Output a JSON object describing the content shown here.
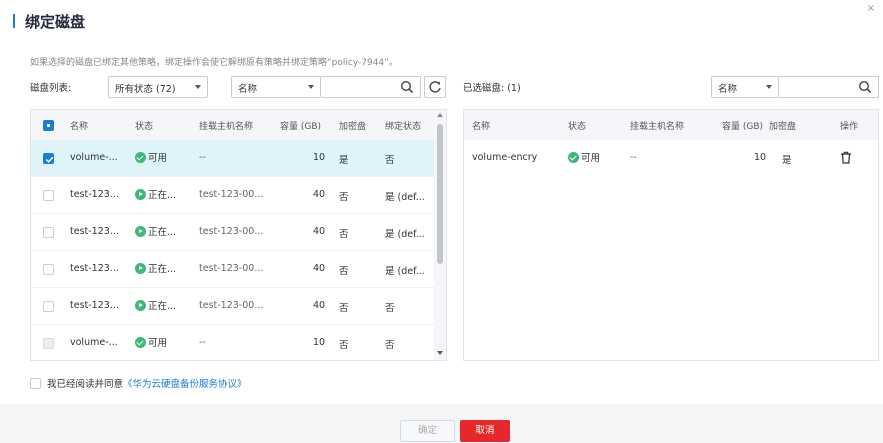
{
  "dialog": {
    "title": "绑定磁盘",
    "close_glyph": "×",
    "notice": "如果选择的磁盘已绑定其他策略，绑定操作会使它解绑原有策略并绑定策略“policy-7944”。"
  },
  "left": {
    "list_label": "磁盘列表:",
    "status_filter": "所有状态 (72)",
    "field_select": "名称",
    "search_value": "",
    "columns": [
      "名称",
      "状态",
      "挂载主机名称",
      "容量 (GB)",
      "加密盘",
      "绑定状态"
    ],
    "rows": [
      {
        "name": "volume-...",
        "status": "可用",
        "status_kind": "green",
        "host": "--",
        "capacity": "10",
        "encrypted": "是",
        "bound": "否",
        "checkbox": "checked",
        "selected": true
      },
      {
        "name": "test-123...",
        "status": "正在...",
        "status_kind": "arrow",
        "host": "test-123-00...",
        "capacity": "40",
        "encrypted": "否",
        "bound": "是 (def...",
        "checkbox": "empty",
        "selected": false
      },
      {
        "name": "test-123...",
        "status": "正在...",
        "status_kind": "arrow",
        "host": "test-123-00...",
        "capacity": "40",
        "encrypted": "否",
        "bound": "是 (def...",
        "checkbox": "empty",
        "selected": false
      },
      {
        "name": "test-123...",
        "status": "正在...",
        "status_kind": "arrow",
        "host": "test-123-00...",
        "capacity": "40",
        "encrypted": "否",
        "bound": "是 (def...",
        "checkbox": "empty",
        "selected": false
      },
      {
        "name": "test-123...",
        "status": "正在...",
        "status_kind": "arrow",
        "host": "test-123-00...",
        "capacity": "40",
        "encrypted": "否",
        "bound": "否",
        "checkbox": "empty",
        "selected": false
      },
      {
        "name": "volume-...",
        "status": "可用",
        "status_kind": "green",
        "host": "--",
        "capacity": "10",
        "encrypted": "否",
        "bound": "否",
        "checkbox": "disabled",
        "selected": false
      }
    ]
  },
  "right": {
    "selected_label": "已选磁盘: (1)",
    "field_select": "名称",
    "search_value": "",
    "columns": [
      "名称",
      "状态",
      "挂载主机名称",
      "容量 (GB)",
      "加密盘",
      "操作"
    ],
    "rows": [
      {
        "name": "volume-encry",
        "status": "可用",
        "status_kind": "green",
        "host": "--",
        "capacity": "10",
        "encrypted": "是",
        "action_icon": "trash-icon"
      }
    ]
  },
  "agreement": {
    "prefix": "我已经阅读并同意",
    "link": "《华为云硬盘备份服务协议》"
  },
  "footer": {
    "ok_label": "确定",
    "cancel_label": "取消"
  },
  "colors": {
    "accent": "#1a7bd8",
    "success": "#3cb878",
    "danger": "#e6282d",
    "selected_row": "#dff4f9"
  }
}
